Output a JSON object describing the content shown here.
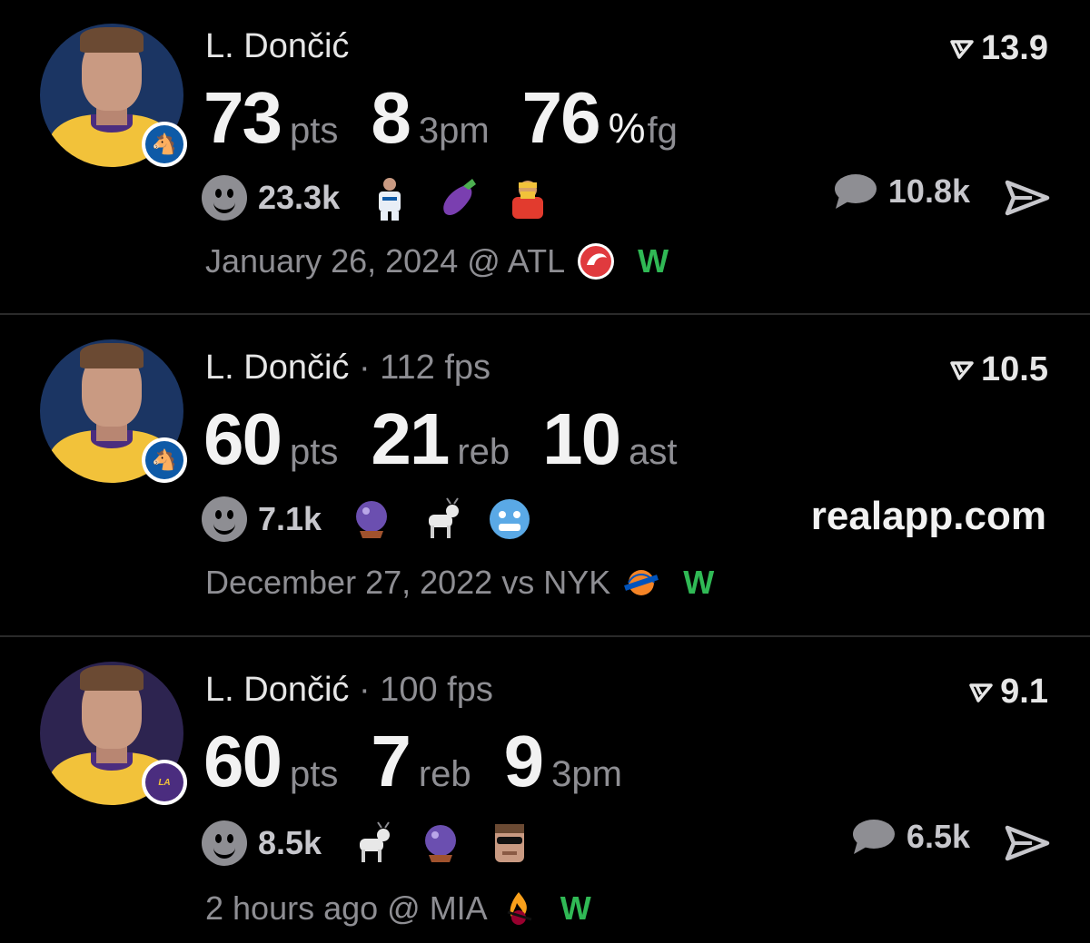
{
  "cards": [
    {
      "player": "L. Dončić",
      "fps": "",
      "score": "13.9",
      "stats": [
        {
          "num": "73",
          "unit": "pts"
        },
        {
          "num": "8",
          "unit": "3pm"
        },
        {
          "num": "76",
          "pct": "%",
          "unit": "fg"
        }
      ],
      "reactions": "23.3k",
      "emojis": [
        "dallas-player-emoji",
        "eggplant-emoji",
        "hulk-hogan-emoji"
      ],
      "comments": "10.8k",
      "date": "January 26, 2024 @ ATL",
      "team_logo": "hawks-logo",
      "result": "W"
    },
    {
      "player": "L. Dončić",
      "fps": "· 112 fps",
      "score": "10.5",
      "stats": [
        {
          "num": "60",
          "unit": "pts"
        },
        {
          "num": "21",
          "unit": "reb"
        },
        {
          "num": "10",
          "unit": "ast"
        }
      ],
      "reactions": "7.1k",
      "emojis": [
        "crystal-ball-emoji",
        "goat-emoji",
        "cold-face-emoji"
      ],
      "link": "realapp.com",
      "date": "December 27, 2022 vs NYK",
      "team_logo": "knicks-logo",
      "result": "W"
    },
    {
      "player": "L. Dončić",
      "fps": "· 100 fps",
      "score": "9.1",
      "stats": [
        {
          "num": "60",
          "unit": "pts"
        },
        {
          "num": "7",
          "unit": "reb"
        },
        {
          "num": "9",
          "unit": "3pm"
        }
      ],
      "reactions": "8.5k",
      "emojis": [
        "goat-emoji",
        "crystal-ball-emoji",
        "sunglasses-player-emoji"
      ],
      "comments": "6.5k",
      "date": "2 hours ago @ MIA",
      "team_logo": "heat-logo",
      "result": "W"
    }
  ],
  "colors": {
    "background": "#000000",
    "muted": "#8e8e93",
    "win": "#30b955"
  }
}
